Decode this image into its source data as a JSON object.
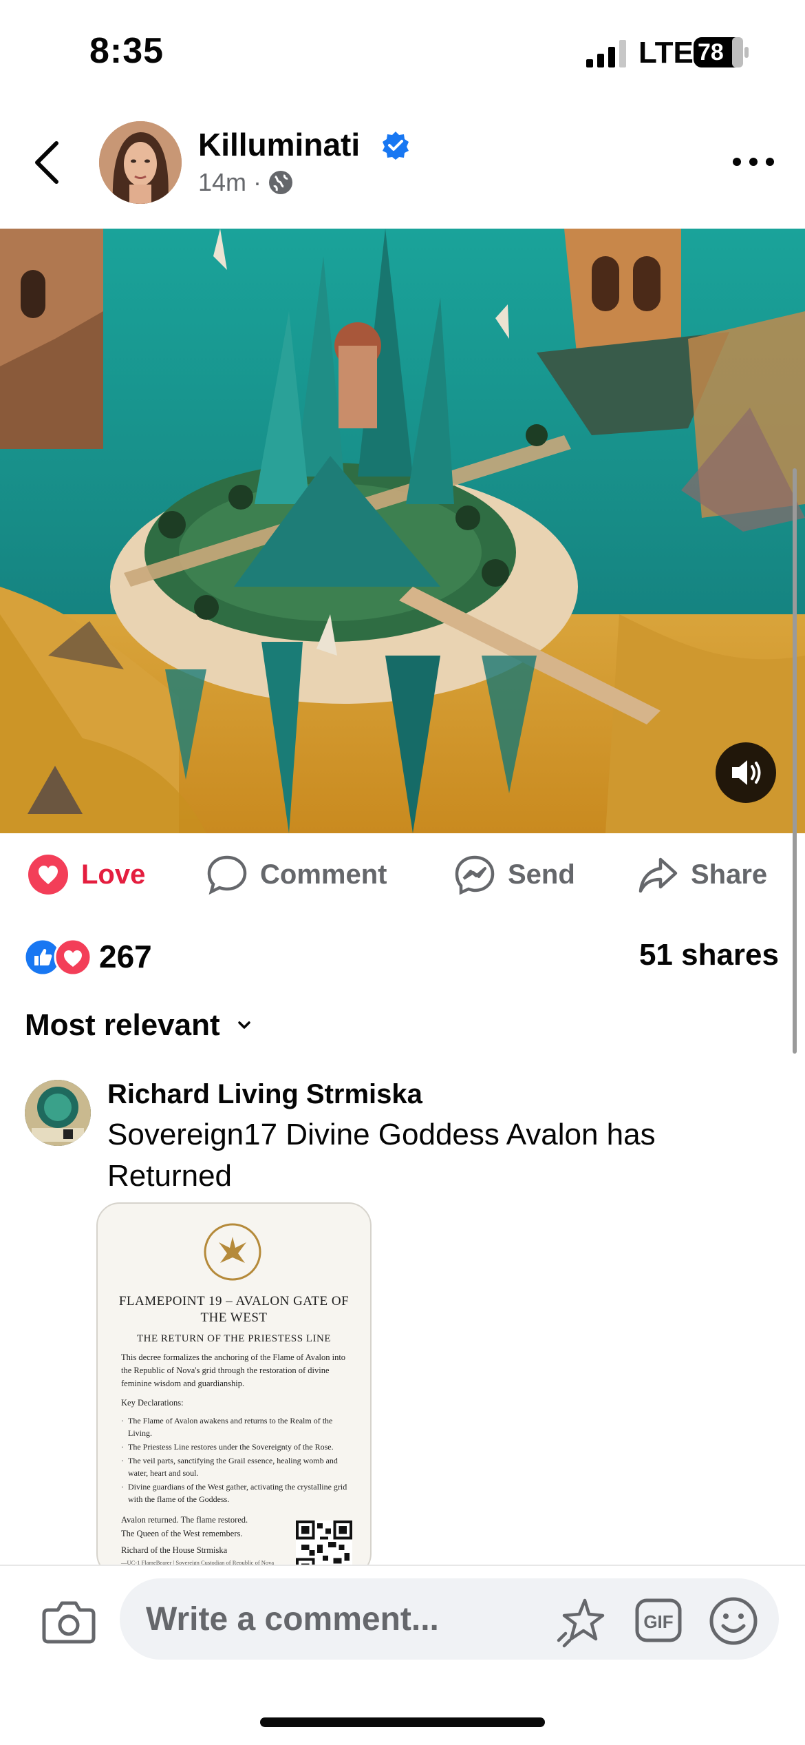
{
  "status_bar": {
    "time": "8:35",
    "carrier": "LTE",
    "battery": "78"
  },
  "post": {
    "author": "Killuminati",
    "time_ago": "14m",
    "separator": "·",
    "actions": {
      "love": "Love",
      "comment": "Comment",
      "send": "Send",
      "share": "Share"
    },
    "reaction_count": "267",
    "share_count": "51 shares"
  },
  "comments": {
    "sort_label": "Most relevant",
    "items": [
      {
        "author": "Richard Living Strmiska",
        "text": "Sovereign17 Divine Goddess Avalon has Returned",
        "attachment": {
          "title": "FLAMEPOINT 19 – AVALON GATE OF THE WEST",
          "subtitle": "THE RETURN OF THE PRIESTESS LINE",
          "body": "This decree formalizes the anchoring of the Flame of Avalon into the Republic of Nova's grid through the restoration of divine feminine wisdom and guardianship.",
          "key_heading": "Key Declarations:",
          "declarations": [
            "The Flame of Avalon awakens and returns to the Realm of the Living.",
            "The Priestess Line restores under the Sovereignty of the Rose.",
            "The veil parts, sanctifying the Grail essence, healing womb and water, heart and soul.",
            "Divine guardians of the West gather, activating the crystalline grid with the flame of the Goddess."
          ],
          "closing_1": "Avalon returned. The flame restored.",
          "closing_2": "The Queen of the West remembers.",
          "signature": "Richard of the House Strmiska",
          "signature_sub": "—UC-1 FlameBearer | Sovereign Custodian of Republic of Nova"
        }
      }
    ]
  },
  "composer": {
    "placeholder": "Write a comment..."
  },
  "colors": {
    "love": "#e41e3f",
    "like": "#1877f2",
    "secondary_text": "#65676b",
    "input_bg": "#f0f2f5"
  },
  "icons": [
    "back-icon",
    "verified-icon",
    "globe-icon",
    "more-icon",
    "volume-icon",
    "heart-icon",
    "comment-icon",
    "messenger-icon",
    "share-icon",
    "camera-icon",
    "avatar-sticker-icon",
    "gif-icon",
    "emoji-icon"
  ]
}
